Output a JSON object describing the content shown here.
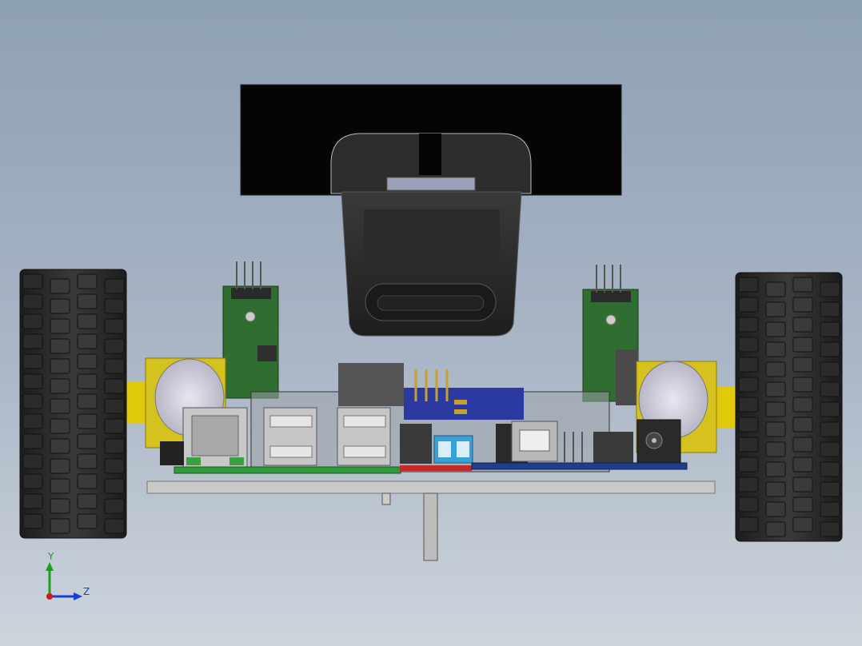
{
  "viewport": {
    "background_top": "#8ea0b4",
    "background_bottom": "#cdd4dc"
  },
  "model": {
    "parts": [
      "left-wheel",
      "right-wheel",
      "chassis-plate",
      "caster-post",
      "left-motor",
      "right-motor",
      "webcam",
      "display-board",
      "ethernet-jack",
      "usb-ports",
      "usb-b-port",
      "dc-jack",
      "sensor-board-left",
      "sensor-board-right",
      "terminal-blocks"
    ],
    "colors": {
      "tire": "#262626",
      "pcb_green": "#2f7a3a",
      "pcb_blue": "#1f3f8a",
      "motor_yellow": "#d6c21f",
      "plate": "#c9c9c9",
      "webcam": "#2a2a2a",
      "display": "#050505",
      "terminal_blue": "#3aa0d8"
    }
  },
  "triad": {
    "y_label": "Y",
    "z_label": "Z",
    "y_color": "#1aa01a",
    "z_color": "#1a3fd0",
    "origin_color": "#d01a1a"
  }
}
